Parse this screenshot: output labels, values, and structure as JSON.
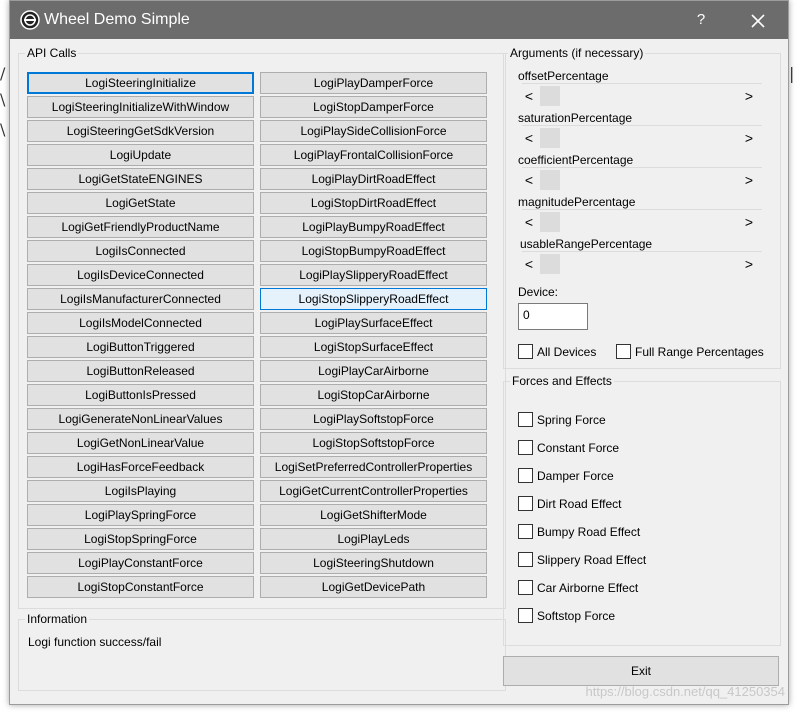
{
  "window": {
    "title": "Wheel Demo Simple",
    "help_label": "?",
    "app_icon": "steering-wheel-icon",
    "close_icon": "close-icon"
  },
  "api_calls": {
    "label": "API Calls",
    "left": [
      "LogiSteeringInitialize",
      "LogiSteeringInitializeWithWindow",
      "LogiSteeringGetSdkVersion",
      "LogiUpdate",
      "LogiGetStateENGINES",
      "LogiGetState",
      "LogiGetFriendlyProductName",
      "LogiIsConnected",
      "LogiIsDeviceConnected",
      "LogiIsManufacturerConnected",
      "LogiIsModelConnected",
      "LogiButtonTriggered",
      "LogiButtonReleased",
      "LogiButtonIsPressed",
      "LogiGenerateNonLinearValues",
      "LogiGetNonLinearValue",
      "LogiHasForceFeedback",
      "LogiIsPlaying",
      "LogiPlaySpringForce",
      "LogiStopSpringForce",
      "LogiPlayConstantForce",
      "LogiStopConstantForce"
    ],
    "right": [
      "LogiPlayDamperForce",
      "LogiStopDamperForce",
      "LogiPlaySideCollisionForce",
      "LogiPlayFrontalCollisionForce",
      "LogiPlayDirtRoadEffect",
      "LogiStopDirtRoadEffect",
      "LogiPlayBumpyRoadEffect",
      "LogiStopBumpyRoadEffect",
      "LogiPlaySlipperyRoadEffect",
      "LogiStopSlipperyRoadEffect",
      "LogiPlaySurfaceEffect",
      "LogiStopSurfaceEffect",
      "LogiPlayCarAirborne",
      "LogiStopCarAirborne",
      "LogiPlaySoftstopForce",
      "LogiStopSoftstopForce",
      "LogiSetPreferredControllerProperties",
      "LogiGetCurrentControllerProperties",
      "LogiGetShifterMode",
      "LogiPlayLeds",
      "LogiSteeringShutdown",
      "LogiGetDevicePath"
    ]
  },
  "arguments": {
    "label": "Arguments (if necessary)",
    "sliders": [
      "offsetPercentage",
      "saturationPercentage",
      "coefficientPercentage",
      "magnitudePercentage",
      "usableRangePercentage"
    ],
    "left_arrow": "<",
    "right_arrow": ">",
    "device_label": "Device:",
    "device_value": "0",
    "all_devices": "All Devices",
    "full_range": "Full Range Percentages"
  },
  "forces": {
    "label": "Forces and Effects",
    "items": [
      "Spring Force",
      "Constant Force",
      "Damper Force",
      "Dirt Road Effect",
      "Bumpy Road Effect",
      "Slippery Road Effect",
      "Car Airborne Effect",
      "Softstop Force"
    ]
  },
  "information": {
    "label": "Information",
    "text": "Logi function success/fail"
  },
  "exit_label": "Exit",
  "watermark": "https://blog.csdn.net/qq_41250354"
}
